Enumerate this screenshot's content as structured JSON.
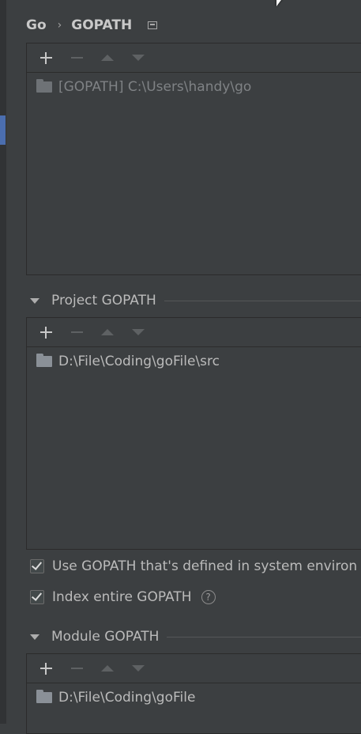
{
  "breadcrumb": {
    "parent": "Go",
    "separator": "›",
    "current": "GOPATH"
  },
  "global_gopath": {
    "toolbar": [
      "add-icon",
      "remove-icon",
      "move-up-icon",
      "move-down-icon"
    ],
    "items": [
      {
        "label": "[GOPATH] C:\\Users\\handy\\go",
        "disabled": true
      }
    ]
  },
  "project_gopath": {
    "title": "Project GOPATH",
    "items": [
      {
        "label": "D:\\File\\Coding\\goFile\\src"
      }
    ]
  },
  "options": {
    "use_system_env_label": "Use GOPATH that's defined in system environ",
    "use_system_env_checked": true,
    "index_entire_label": "Index entire GOPATH",
    "index_entire_checked": true,
    "help_glyph": "?"
  },
  "module_gopath": {
    "title": "Module GOPATH",
    "items": [
      {
        "label": "D:\\File\\Coding\\goFile"
      }
    ]
  },
  "colors": {
    "background": "#3c3f41",
    "accent": "#4b6eaf",
    "text": "#bbbbbb",
    "border": "#2b2b2b"
  }
}
